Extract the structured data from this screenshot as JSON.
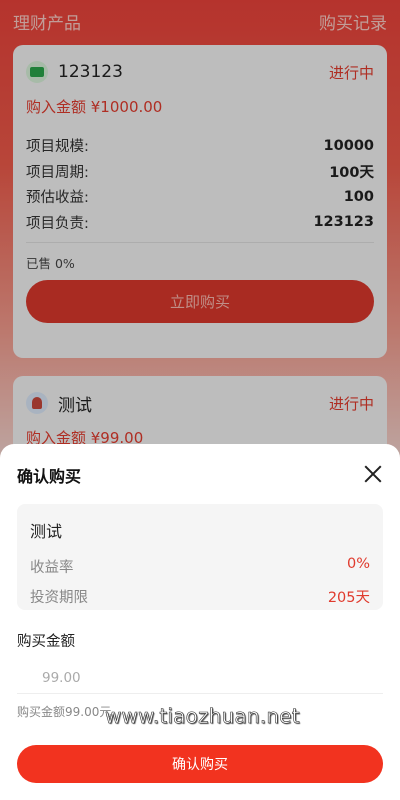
{
  "header": {
    "title": "理财产品",
    "records_link": "购买记录"
  },
  "products": [
    {
      "icon": "money-icon",
      "name": "123123",
      "status": "进行中",
      "amount": "购入金额 ¥1000.00",
      "details": [
        {
          "label": "项目规模:",
          "value": "10000"
        },
        {
          "label": "项目周期:",
          "value": "100天"
        },
        {
          "label": "预估收益:",
          "value": "100"
        },
        {
          "label": "项目负责:",
          "value": "123123"
        }
      ],
      "sold": "已售 0%",
      "buy_label": "立即购买"
    },
    {
      "icon": "avatar-icon",
      "name": "测试",
      "status": "进行中",
      "amount": "购入金额 ¥99.00"
    }
  ],
  "modal": {
    "title": "确认购买",
    "product_name": "测试",
    "rate_label": "收益率",
    "rate_value": "0%",
    "term_label": "投资期限",
    "term_value": "205天",
    "amount_label": "购买金额",
    "amount_placeholder": "99.00",
    "amount_hint": "购买金额99.00元",
    "confirm_label": "确认购买"
  },
  "watermark": "www.tiaozhuan.net",
  "colors": {
    "accent": "#e03b2e",
    "button": "#f2331f"
  }
}
